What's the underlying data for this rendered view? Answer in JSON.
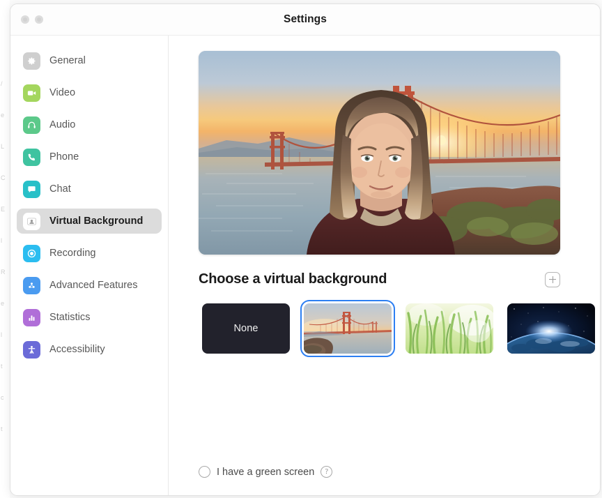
{
  "window": {
    "title": "Settings",
    "traffic_lights": [
      "close",
      "minimize"
    ]
  },
  "sidebar": {
    "items": [
      {
        "label": "General",
        "icon": "gear-icon",
        "color": "#cfcfcf",
        "selected": false
      },
      {
        "label": "Video",
        "icon": "video-camera-icon",
        "color": "#a4d65e",
        "selected": false
      },
      {
        "label": "Audio",
        "icon": "headphones-icon",
        "color": "#5cc98a",
        "selected": false
      },
      {
        "label": "Phone",
        "icon": "phone-icon",
        "color": "#3fc3a0",
        "selected": false
      },
      {
        "label": "Chat",
        "icon": "chat-bubble-icon",
        "color": "#28c0c8",
        "selected": false
      },
      {
        "label": "Virtual Background",
        "icon": "person-card-icon",
        "color": "#ffffff",
        "selected": true
      },
      {
        "label": "Recording",
        "icon": "record-circle-icon",
        "color": "#2bbdf0",
        "selected": false
      },
      {
        "label": "Advanced Features",
        "icon": "sparkle-icon",
        "color": "#4a9bf0",
        "selected": false
      },
      {
        "label": "Statistics",
        "icon": "bar-chart-icon",
        "color": "#b06ed8",
        "selected": false
      },
      {
        "label": "Accessibility",
        "icon": "accessibility-icon",
        "color": "#6b6bd8",
        "selected": false
      }
    ]
  },
  "main": {
    "preview": {
      "name": "video-preview",
      "description": "Webcam preview of a person with the Golden Gate Bridge sunset virtual background applied"
    },
    "section_title": "Choose a virtual background",
    "add_button": {
      "label": "+",
      "icon": "plus-icon"
    },
    "backgrounds": [
      {
        "name": "None",
        "type": "none",
        "selected": false
      },
      {
        "name": "Golden Gate Bridge",
        "type": "image",
        "selected": true
      },
      {
        "name": "Grass",
        "type": "image",
        "selected": false
      },
      {
        "name": "Earth from space",
        "type": "image",
        "selected": false
      }
    ],
    "green_screen": {
      "label": "I have a green screen",
      "checked": false,
      "help_icon": "?"
    }
  },
  "colors": {
    "accent": "#2d7ff2",
    "selected_nav_bg": "#dcdcdc",
    "window_bg": "#ffffff"
  },
  "background_window_fragments": [
    "/",
    "e",
    "L",
    "C",
    "E",
    "l",
    "R",
    "e",
    "l",
    "t",
    "c",
    "t"
  ]
}
